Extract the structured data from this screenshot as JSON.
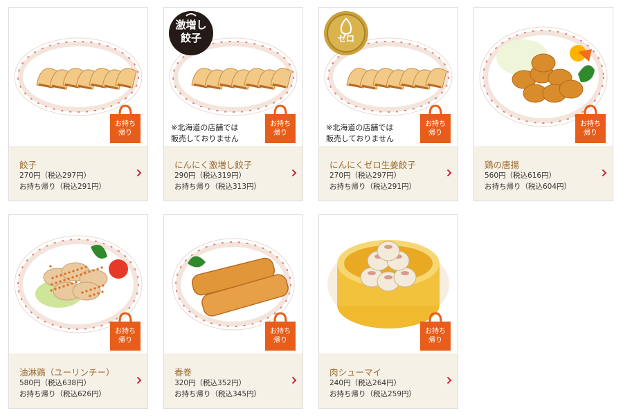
{
  "takeout_tag": "お持ち\n帰り",
  "menu_items": [
    {
      "dish_icon": "gyoza-plate",
      "name": "餃子",
      "price": "270円（税込297円）",
      "takeout_price": "お持ち帰り（税込291円）"
    },
    {
      "dish_icon": "gyoza-plate",
      "badge_icon": "garlic-badge",
      "badge_text": "激増し\n餃子",
      "note": "※北海道の店舗では\n  販売しておりません",
      "name": "にんにく激増し餃子",
      "price": "290円（税込319円）",
      "takeout_price": "お持ち帰り（税込313円）"
    },
    {
      "dish_icon": "gyoza-plate",
      "badge_icon": "zero-garlic-badge",
      "badge_text": "ゼロ",
      "note": "※北海道の店舗では\n  販売しておりません",
      "name": "にんにくゼロ生姜餃子",
      "price": "270円（税込297円）",
      "takeout_price": "お持ち帰り（税込291円）"
    },
    {
      "dish_icon": "karaage-plate",
      "name": "鶏の唐揚",
      "price": "560円（税込616円）",
      "takeout_price": "お持ち帰り（税込604円）"
    },
    {
      "dish_icon": "yurinchi-plate",
      "name": "油淋鶏（ユーリンチー）",
      "price": "580円（税込638円）",
      "takeout_price": "お持ち帰り（税込626円）"
    },
    {
      "dish_icon": "spring-roll-plate",
      "name": "春巻",
      "price": "320円（税込352円）",
      "takeout_price": "お持ち帰り（税込345円）"
    },
    {
      "dish_icon": "shumai-steamer",
      "name": "肉シューマイ",
      "price": "240円（税込264円）",
      "takeout_price": "お持ち帰り（税込259円）"
    }
  ],
  "colors": {
    "name_text": "#9a6b2e",
    "info_bg": "#f6f1e7",
    "takeout_bag": "#e85d1a",
    "chevron": "#c8102e",
    "plate_rim": "#f3e4dc"
  }
}
